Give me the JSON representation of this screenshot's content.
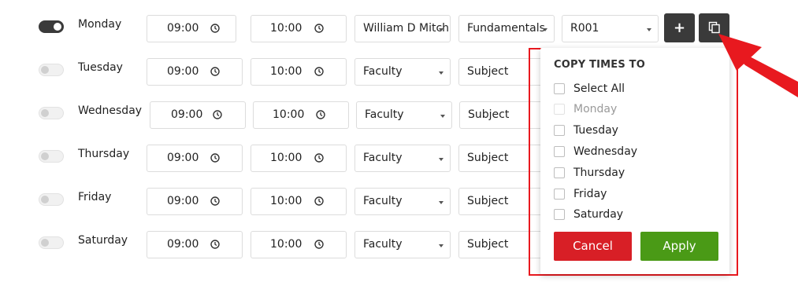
{
  "rows": [
    {
      "day": "Monday",
      "enabled": true,
      "start": "09:00",
      "end": "10:00",
      "faculty": "William D Mitch",
      "subject": "Fundamentals",
      "room": "R001"
    },
    {
      "day": "Tuesday",
      "enabled": false,
      "start": "09:00",
      "end": "10:00",
      "faculty": "Faculty",
      "subject": "Subject"
    },
    {
      "day": "Wednesday",
      "enabled": false,
      "start": "09:00",
      "end": "10:00",
      "faculty": "Faculty",
      "subject": "Subject"
    },
    {
      "day": "Thursday",
      "enabled": false,
      "start": "09:00",
      "end": "10:00",
      "faculty": "Faculty",
      "subject": "Subject"
    },
    {
      "day": "Friday",
      "enabled": false,
      "start": "09:00",
      "end": "10:00",
      "faculty": "Faculty",
      "subject": "Subject"
    },
    {
      "day": "Saturday",
      "enabled": false,
      "start": "09:00",
      "end": "10:00",
      "faculty": "Faculty",
      "subject": "Subject"
    }
  ],
  "actions": {
    "add_label": "+",
    "copy_icon": "copy-icon"
  },
  "popup": {
    "title": "COPY TIMES TO",
    "options": [
      {
        "label": "Select All",
        "disabled": false
      },
      {
        "label": "Monday",
        "disabled": true
      },
      {
        "label": "Tuesday",
        "disabled": false
      },
      {
        "label": "Wednesday",
        "disabled": false
      },
      {
        "label": "Thursday",
        "disabled": false
      },
      {
        "label": "Friday",
        "disabled": false
      },
      {
        "label": "Saturday",
        "disabled": false
      }
    ],
    "cancel_label": "Cancel",
    "apply_label": "Apply"
  },
  "colors": {
    "cancel": "#d81f26",
    "apply": "#4a9a16",
    "dark_button": "#3a3a3a",
    "highlight": "#e8191f"
  }
}
